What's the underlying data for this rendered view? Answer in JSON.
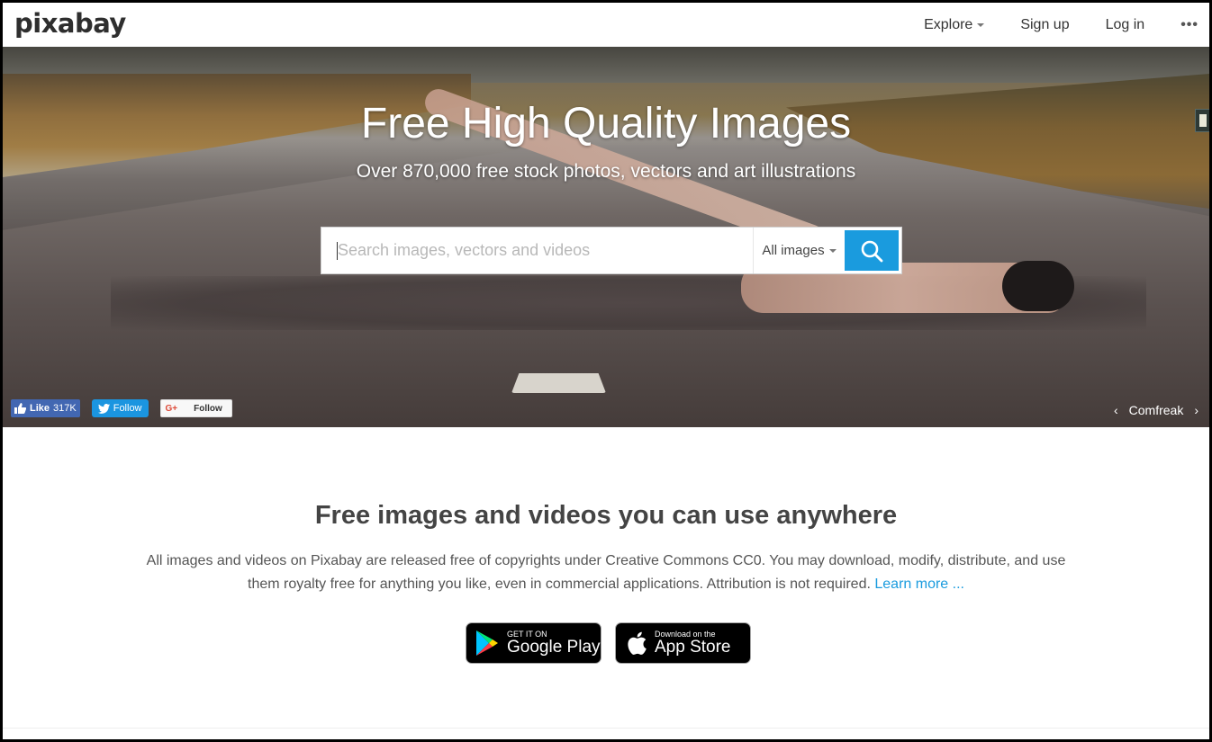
{
  "header": {
    "logo": "pixabay",
    "nav": [
      {
        "label": "Explore",
        "has_caret": true
      },
      {
        "label": "Sign up"
      },
      {
        "label": "Log in"
      }
    ],
    "more": "•••"
  },
  "hero": {
    "title": "Free High Quality Images",
    "subtitle": "Over 870,000 free stock photos, vectors and art illustrations",
    "search": {
      "placeholder": "Search images, vectors and videos",
      "value": "",
      "type_selected": "All images"
    },
    "social": {
      "fb_label": "Like",
      "fb_count": "317K",
      "twitter_label": "Follow",
      "gplus_icon": "G+",
      "gplus_label": "Follow"
    },
    "credit": {
      "prev": "‹",
      "author": "Comfreak",
      "next": "›"
    }
  },
  "content": {
    "title": "Free images and videos you can use anywhere",
    "text": "All images and videos on Pixabay are released free of copyrights under Creative Commons CC0. You may download, modify, distribute, and use them royalty free for anything you like, even in commercial applications. Attribution is not required.",
    "learn_more": "Learn more ...",
    "stores": {
      "google": {
        "small": "GET IT ON",
        "big": "Google Play"
      },
      "apple": {
        "small": "Download on the",
        "big": "App Store"
      }
    }
  },
  "colors": {
    "accent": "#1a9bde",
    "facebook": "#4267b2",
    "twitter": "#1b95e0"
  }
}
